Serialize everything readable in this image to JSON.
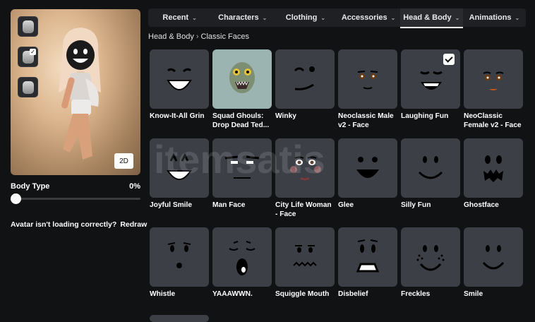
{
  "avatar": {
    "view_buttons": [
      {
        "icon": "head-grey-icon",
        "checked": false
      },
      {
        "icon": "head-face-icon",
        "checked": true
      },
      {
        "icon": "head-smile-icon",
        "checked": false
      }
    ],
    "toggle_label": "2D",
    "body_type_label": "Body Type",
    "body_type_value": "0%",
    "body_type_fraction": 0,
    "loading_message": "Avatar isn't loading correctly?",
    "redraw_label": "Redraw"
  },
  "tabs": [
    {
      "label": "Recent",
      "active": false
    },
    {
      "label": "Characters",
      "active": false
    },
    {
      "label": "Clothing",
      "active": false
    },
    {
      "label": "Accessories",
      "active": false
    },
    {
      "label": "Head & Body",
      "active": true
    },
    {
      "label": "Animations",
      "active": false
    }
  ],
  "breadcrumb": [
    "Head & Body",
    "Classic Faces"
  ],
  "items": [
    {
      "name": "Know-It-All Grin",
      "face": "grin",
      "equipped": false
    },
    {
      "name": "Squad Ghouls: Drop Dead Ted...",
      "face": "ghoul",
      "equipped": false
    },
    {
      "name": "Winky",
      "face": "winky",
      "equipped": false
    },
    {
      "name": "Neoclassic Male v2 - Face",
      "face": "neomale",
      "equipped": false
    },
    {
      "name": "Laughing Fun",
      "face": "laughing",
      "equipped": true
    },
    {
      "name": "NeoClassic Female v2 - Face",
      "face": "neofemale",
      "equipped": false
    },
    {
      "name": "Joyful Smile",
      "face": "joyful",
      "equipped": false
    },
    {
      "name": "Man Face",
      "face": "man",
      "equipped": false
    },
    {
      "name": "City Life Woman - Face",
      "face": "citywoman",
      "equipped": false
    },
    {
      "name": "Glee",
      "face": "glee",
      "equipped": false
    },
    {
      "name": "Silly Fun",
      "face": "silly",
      "equipped": false
    },
    {
      "name": "Ghostface",
      "face": "ghost",
      "equipped": false
    },
    {
      "name": "Whistle",
      "face": "whistle",
      "equipped": false
    },
    {
      "name": "YAAAWWN.",
      "face": "yawn",
      "equipped": false
    },
    {
      "name": "Squiggle Mouth",
      "face": "squiggle",
      "equipped": false
    },
    {
      "name": "Disbelief",
      "face": "disbelief",
      "equipped": false
    },
    {
      "name": "Freckles",
      "face": "freckles",
      "equipped": false
    },
    {
      "name": "Smile",
      "face": "smile",
      "equipped": false
    }
  ],
  "watermark_text": "itemsatis"
}
